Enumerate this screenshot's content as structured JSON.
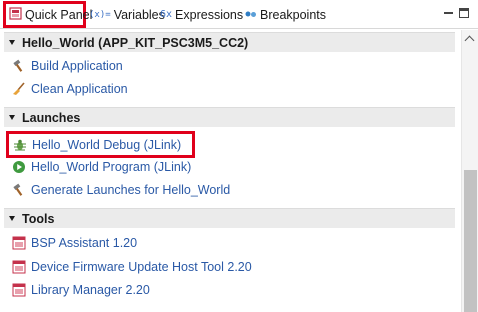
{
  "tabs": [
    {
      "label": "Quick Panel",
      "icon": "quick-panel-icon"
    },
    {
      "label": "Variables",
      "icon": "variables-icon"
    },
    {
      "label": "Expressions",
      "icon": "expressions-icon"
    },
    {
      "label": "Breakpoints",
      "icon": "breakpoints-icon"
    }
  ],
  "sections": {
    "project": {
      "title": "Hello_World (APP_KIT_PSC3M5_CC2)",
      "items": [
        "Build Application",
        "Clean Application"
      ]
    },
    "launches": {
      "title": "Launches",
      "items": [
        "Hello_World Debug (JLink)",
        "Hello_World Program (JLink)",
        "Generate Launches for Hello_World"
      ]
    },
    "tools": {
      "title": "Tools",
      "items": [
        "BSP Assistant 1.20",
        "Device Firmware Update Host Tool 2.20",
        "Library Manager 2.20"
      ]
    }
  },
  "colors": {
    "link": "#2a59a6",
    "highlight": "#e0001b",
    "section_bg": "#ebebeb"
  }
}
